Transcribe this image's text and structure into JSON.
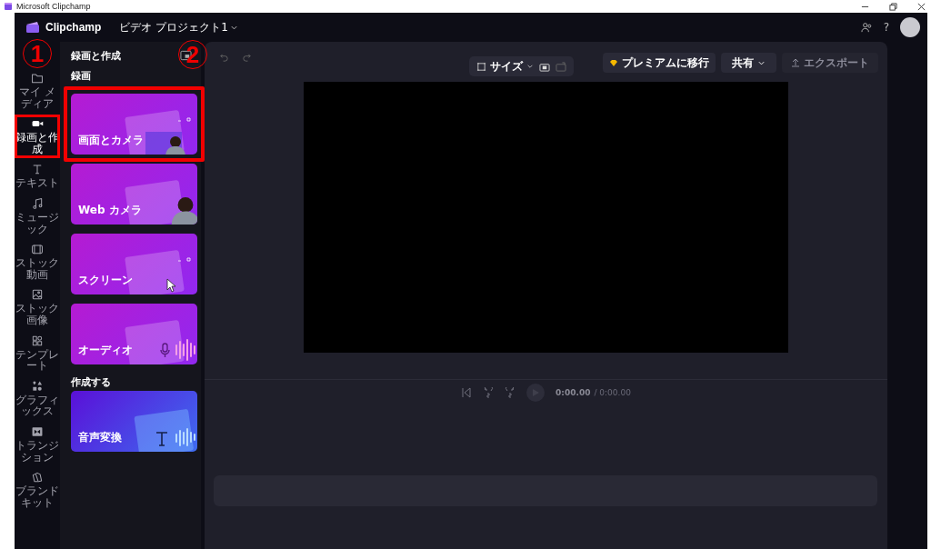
{
  "window": {
    "title": "Microsoft Clipchamp"
  },
  "topbar": {
    "brand": "Clipchamp",
    "project": "ビデオ プロジェクト1",
    "help": "?"
  },
  "sidebar": {
    "items": [
      {
        "label": "マイ メディア",
        "selected": false,
        "highlighted": false
      },
      {
        "label": "録画と作成",
        "selected": true,
        "highlighted": true
      },
      {
        "label": "テキスト",
        "selected": false,
        "highlighted": false
      },
      {
        "label": "ミュージック",
        "selected": false,
        "highlighted": false
      },
      {
        "label": "ストック動画",
        "selected": false,
        "highlighted": false
      },
      {
        "label": "ストック画像",
        "selected": false,
        "highlighted": false
      },
      {
        "label": "テンプレート",
        "selected": false,
        "highlighted": false
      },
      {
        "label": "グラフィックス",
        "selected": false,
        "highlighted": false
      },
      {
        "label": "トランジション",
        "selected": false,
        "highlighted": false
      },
      {
        "label": "ブランドキット",
        "selected": false,
        "highlighted": false
      }
    ]
  },
  "panel": {
    "title": "録画と作成",
    "sections": [
      {
        "title": "録画",
        "cards": [
          {
            "label": "画面とカメラ",
            "kind": "screen-camera",
            "highlighted": true
          },
          {
            "label": "Web カメラ",
            "kind": "webcam",
            "highlighted": false
          },
          {
            "label": "スクリーン",
            "kind": "screen",
            "highlighted": false
          },
          {
            "label": "オーディオ",
            "kind": "audio",
            "highlighted": false
          }
        ]
      },
      {
        "title": "作成する",
        "cards": [
          {
            "label": "音声変換",
            "kind": "tts",
            "highlighted": false
          }
        ]
      }
    ]
  },
  "toolbar": {
    "size": "サイズ",
    "premium": "プレミアムに移行",
    "share": "共有",
    "export": {
      "label": "エクスポート",
      "disabled": true
    }
  },
  "playback": {
    "current": "0:00.00",
    "total": "/ 0:00.00"
  },
  "callouts": [
    {
      "text": "1"
    },
    {
      "text": "2"
    }
  ]
}
